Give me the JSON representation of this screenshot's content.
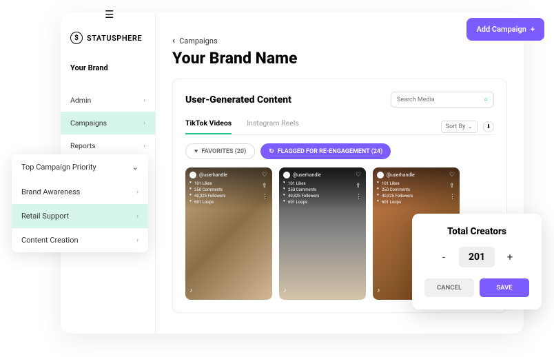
{
  "logo": {
    "text": "STATUSPHERE",
    "icon": "$"
  },
  "sidebar": {
    "brand_label": "Your Brand",
    "items": [
      {
        "label": "Admin",
        "active": false
      },
      {
        "label": "Campaigns",
        "active": true
      },
      {
        "label": "Reports",
        "active": false
      }
    ]
  },
  "breadcrumb": {
    "back": "‹",
    "label": "Campaigns"
  },
  "page_title": "Your Brand Name",
  "add_button": {
    "label": "Add Campaign",
    "plus": "+"
  },
  "card": {
    "title": "User-Generated Content",
    "search_placeholder": "Search Media",
    "tabs": [
      {
        "label": "TikTok Videos",
        "active": true
      },
      {
        "label": "Instagram Reels",
        "active": false
      }
    ],
    "sort_label": "Sort By",
    "chips": {
      "favorites": "FAVORITES (20)",
      "flagged": "FLAGGED FOR RE-ENGAGEMENT (24)"
    },
    "videos": [
      {
        "handle": "@userhandle",
        "likes": "101 Likes",
        "comments": "250 Comments",
        "followers": "40,325 Followers",
        "loops": "601 Loops"
      },
      {
        "handle": "@userhandle",
        "likes": "101 Likes",
        "comments": "250 Comments",
        "followers": "40,325 Followers",
        "loops": "601 Loops"
      },
      {
        "handle": "@userhandle",
        "likes": "101 Likes",
        "comments": "250 Comments",
        "followers": "40,325 Followers",
        "loops": "601 Loops"
      }
    ]
  },
  "dropdown": {
    "header": "Top Campaign Priority",
    "items": [
      {
        "label": "Brand Awareness",
        "active": false
      },
      {
        "label": "Retail Support",
        "active": true
      },
      {
        "label": "Content Creation",
        "active": false
      }
    ]
  },
  "modal": {
    "title": "Total Creators",
    "value": "201",
    "cancel": "CANCEL",
    "save": "SAVE"
  }
}
